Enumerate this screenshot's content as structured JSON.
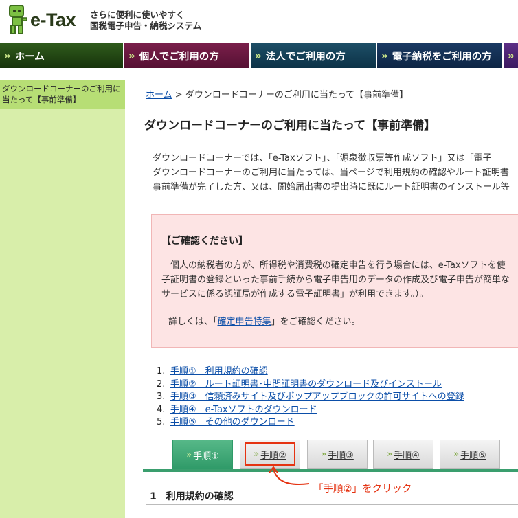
{
  "header": {
    "logo_text": "e-Tax",
    "tagline_line1": "さらに便利に使いやすく",
    "tagline_line2": "国税電子申告・納税システム"
  },
  "nav": {
    "items": [
      {
        "label": "ホーム"
      },
      {
        "label": "個人でご利用の方"
      },
      {
        "label": "法人でご利用の方"
      },
      {
        "label": "電子納税をご利用の方"
      }
    ],
    "arrow": "»"
  },
  "sidebar": {
    "items": [
      {
        "label": "ダウンロードコーナーのご利用に当たって【事前準備】"
      }
    ]
  },
  "breadcrumb": {
    "home": "ホーム",
    "separator": ">",
    "current": "ダウンロードコーナーのご利用に当たって【事前準備】"
  },
  "page": {
    "title": "ダウンロードコーナーのご利用に当たって【事前準備】",
    "intro_lines": [
      "ダウンロードコーナーでは、「e-Taxソフト」、「源泉徴収票等作成ソフト」又は「電子",
      "ダウンロードコーナーのご利用に当たっては、当ページで利用規約の確認やルート証明書",
      "事前準備が完了した方、又は、開始届出書の提出時に既にルート証明書のインストール等"
    ]
  },
  "notice": {
    "title": "【ご確認ください】",
    "body_lines": [
      "　個人の納税者の方が、所得税や消費税の確定申告を行う場合には、e-Taxソフトを使",
      "子証明書の登録といった事前手続から電子申告用のデータの作成及び電子申告が簡単な",
      "サービスに係る認証局が作成する電子証明書」が利用できます。）。"
    ],
    "more_prefix": "詳しくは、「",
    "more_link": "確定申告特集",
    "more_suffix": "」をご確認ください。"
  },
  "steps": [
    {
      "num": "1.",
      "label": "手順①　利用規約の確認"
    },
    {
      "num": "2.",
      "label": "手順②　ルート証明書･中間証明書のダウンロード及びインストール"
    },
    {
      "num": "3.",
      "label": "手順③　信頼済みサイト及びポップアップブロックの許可サイトへの登録"
    },
    {
      "num": "4.",
      "label": "手順④　e-Taxソフトのダウンロード"
    },
    {
      "num": "5.",
      "label": "手順⑤　その他のダウンロード"
    }
  ],
  "tabs": [
    {
      "label": "手順①",
      "active": true
    },
    {
      "label": "手順②",
      "active": false
    },
    {
      "label": "手順③",
      "active": false
    },
    {
      "label": "手順④",
      "active": false
    },
    {
      "label": "手順⑤",
      "active": false
    }
  ],
  "annotation": "「手順②」をクリック",
  "section": {
    "title": "1　利用規約の確認"
  },
  "colors": {
    "accent_green": "#3a9e6e",
    "annotation_red": "#e53312",
    "sidebar_bg": "#d8eeaa",
    "link_blue": "#0b4ea8"
  }
}
